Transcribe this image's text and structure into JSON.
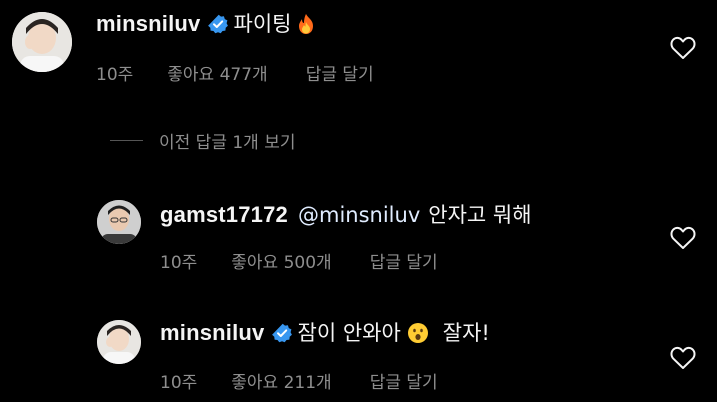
{
  "comments": [
    {
      "username": "minsniluv",
      "verified": true,
      "text": "파이팅",
      "emoji": "fire-emoji",
      "time": "10주",
      "likes_label": "좋아요 477개",
      "reply_label": "답글 달기"
    },
    {
      "username": "gamst17172",
      "verified": false,
      "mention": "@minsniluv",
      "text": "안자고 뭐해",
      "time": "10주",
      "likes_label": "좋아요 500개",
      "reply_label": "답글 달기"
    },
    {
      "username": "minsniluv",
      "verified": true,
      "text": "잠이 안와아",
      "emoji": "hushed-face-emoji",
      "text_after": "잘자!",
      "time": "10주",
      "likes_label": "좋아요 211개",
      "reply_label": "답글 달기"
    }
  ],
  "view_previous_replies": "이전 답글 1개 보기",
  "colors": {
    "background": "#000000",
    "primary_text": "#f5f5f5",
    "secondary_text": "#8e8e8e",
    "verified_badge": "#3897f0"
  },
  "icons": {
    "like": "heart-outline-icon",
    "verified": "verified-badge-icon"
  }
}
